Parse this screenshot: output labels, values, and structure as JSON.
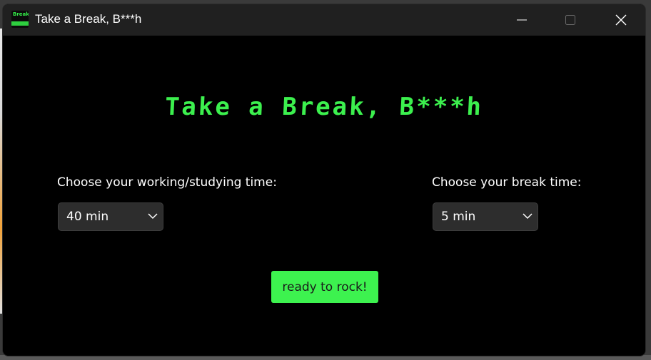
{
  "window": {
    "title": "Take a Break, B***h",
    "app_icon_text": "Break"
  },
  "main": {
    "headline": "Take a Break, B***h",
    "work_time": {
      "label": "Choose your working/studying time:",
      "selected": "40 min"
    },
    "break_time": {
      "label": "Choose your break time:",
      "selected": "5 min"
    },
    "start_button_label": "ready to rock!"
  },
  "colors": {
    "accent_green": "#3df24f",
    "background": "#000000",
    "titlebar": "#202020",
    "select_bg": "#2d2d2d"
  },
  "icons": {
    "minimize": "minimize-icon",
    "maximize": "maximize-icon",
    "close": "close-icon",
    "dropdown": "chevron-down-icon"
  }
}
